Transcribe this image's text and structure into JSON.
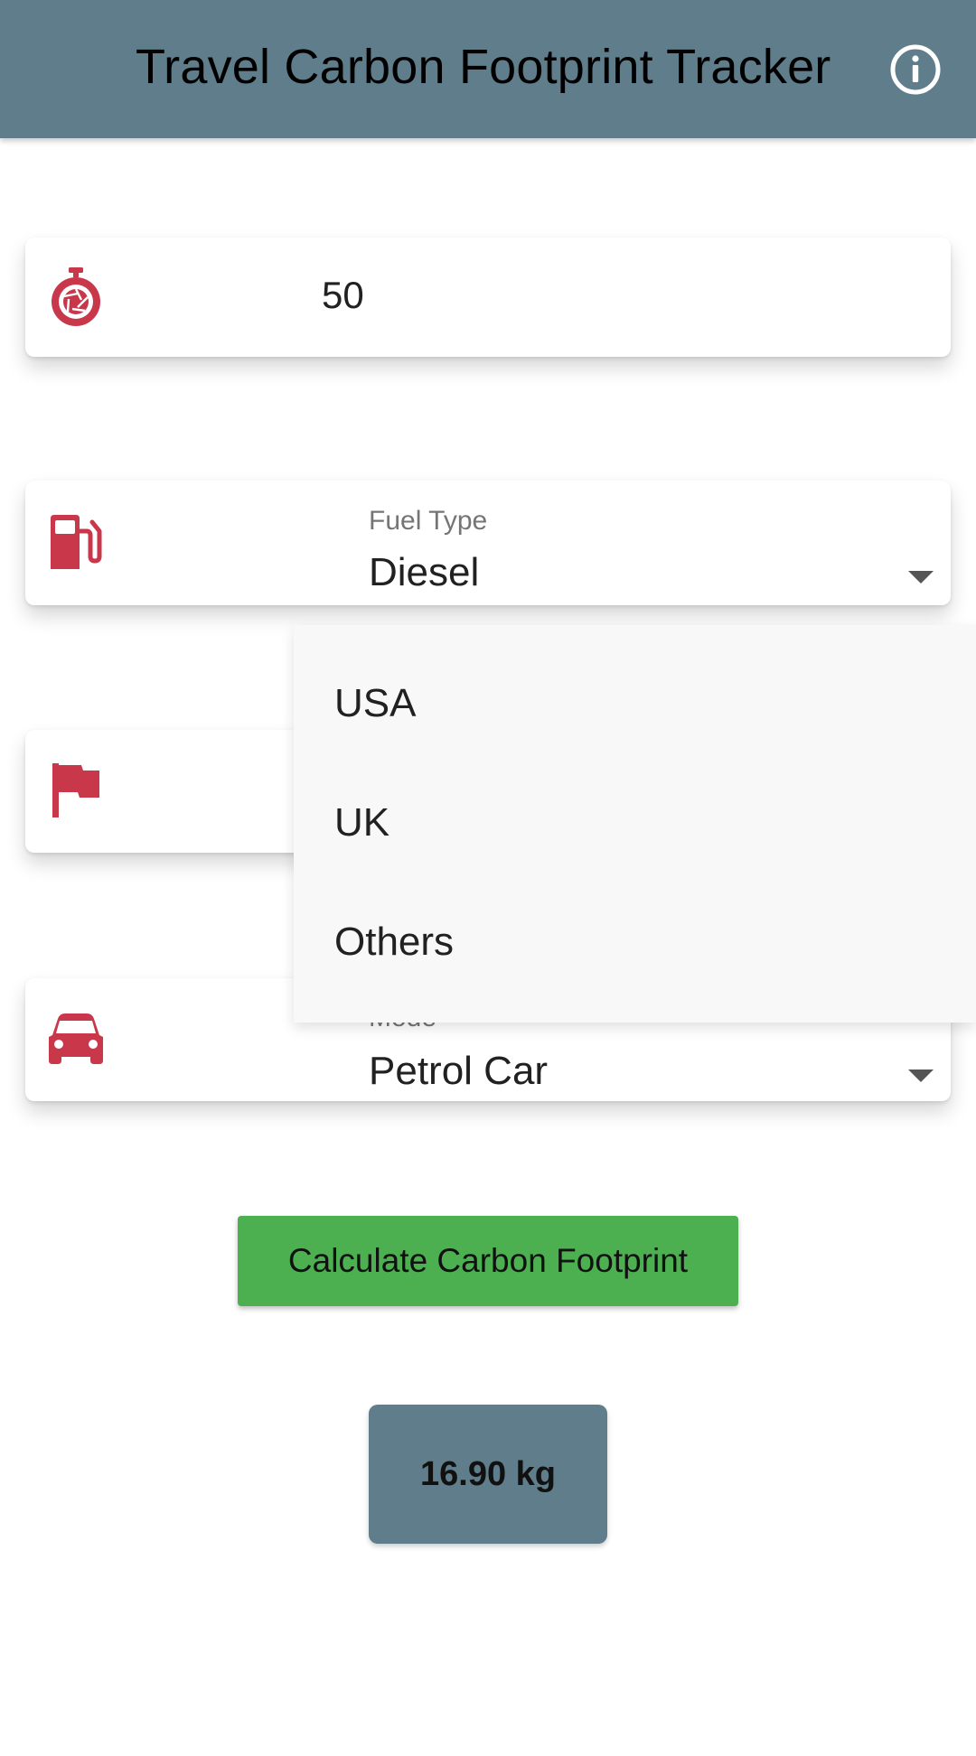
{
  "app": {
    "title": "Travel Carbon Footprint Tracker",
    "bar_color": "#607d8b",
    "icons": {
      "info": "info-circle-icon"
    }
  },
  "distance": {
    "value": "50",
    "icon": "stopwatch-icon"
  },
  "fuel_type": {
    "label": "Fuel Type",
    "selected": "Diesel",
    "icon": "gas-pump-icon"
  },
  "country": {
    "icon": "flag-icon",
    "options": [
      "USA",
      "UK",
      "Others"
    ]
  },
  "mode": {
    "label": "Mode",
    "selected": "Petrol Car",
    "icon": "car-icon"
  },
  "actions": {
    "calculate_label": "Calculate Carbon Footprint"
  },
  "result": {
    "text": "16.90 kg"
  },
  "colors": {
    "accent_icon": "#c8374a",
    "button": "#4caf50",
    "result_bg": "#607d8b"
  }
}
